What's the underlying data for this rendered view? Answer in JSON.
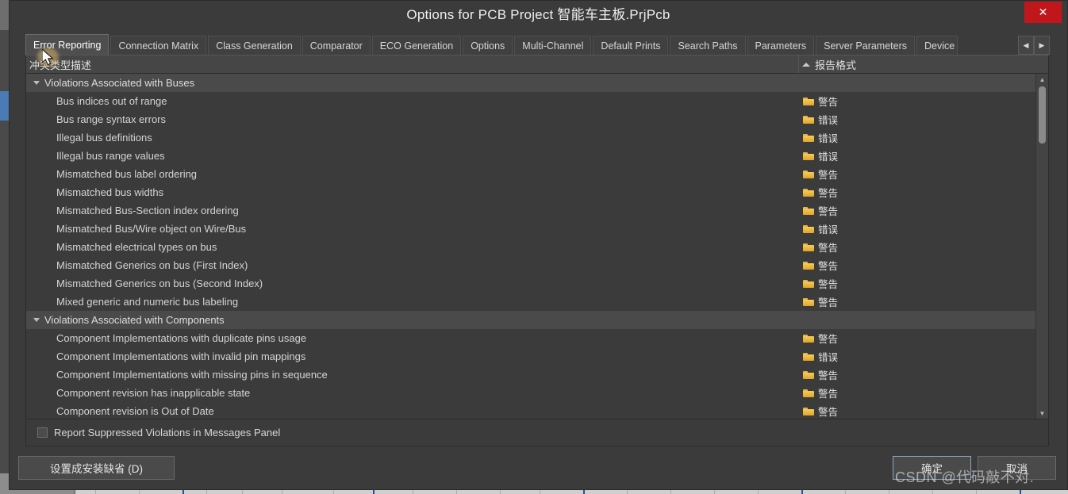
{
  "window": {
    "title": "Options for PCB Project 智能车主板.PrjPcb",
    "close_label": "✕"
  },
  "tabs": {
    "items": [
      {
        "label": "Error Reporting",
        "active": true
      },
      {
        "label": "Connection Matrix",
        "active": false
      },
      {
        "label": "Class Generation",
        "active": false
      },
      {
        "label": "Comparator",
        "active": false
      },
      {
        "label": "ECO Generation",
        "active": false
      },
      {
        "label": "Options",
        "active": false
      },
      {
        "label": "Multi-Channel",
        "active": false
      },
      {
        "label": "Default Prints",
        "active": false
      },
      {
        "label": "Search Paths",
        "active": false
      },
      {
        "label": "Parameters",
        "active": false
      },
      {
        "label": "Server Parameters",
        "active": false
      },
      {
        "label": "Device S",
        "active": false,
        "clipped": true
      }
    ],
    "scroll_left": "◀",
    "scroll_right": "▶"
  },
  "grid": {
    "columns": {
      "description": "冲突类型描述",
      "report_mode": "报告格式"
    },
    "rows": [
      {
        "type": "group",
        "label": "Violations Associated with Buses",
        "format": ""
      },
      {
        "type": "item",
        "label": "Bus indices out of range",
        "format": "警告"
      },
      {
        "type": "item",
        "label": "Bus range syntax errors",
        "format": "错误"
      },
      {
        "type": "item",
        "label": "Illegal bus definitions",
        "format": "错误"
      },
      {
        "type": "item",
        "label": "Illegal bus range values",
        "format": "错误"
      },
      {
        "type": "item",
        "label": "Mismatched bus label ordering",
        "format": "警告"
      },
      {
        "type": "item",
        "label": "Mismatched bus widths",
        "format": "警告"
      },
      {
        "type": "item",
        "label": "Mismatched Bus-Section index ordering",
        "format": "警告"
      },
      {
        "type": "item",
        "label": "Mismatched Bus/Wire object on Wire/Bus",
        "format": "错误"
      },
      {
        "type": "item",
        "label": "Mismatched electrical types on bus",
        "format": "警告"
      },
      {
        "type": "item",
        "label": "Mismatched Generics on bus (First Index)",
        "format": "警告"
      },
      {
        "type": "item",
        "label": "Mismatched Generics on bus (Second Index)",
        "format": "警告"
      },
      {
        "type": "item",
        "label": "Mixed generic and numeric bus labeling",
        "format": "警告"
      },
      {
        "type": "group",
        "label": "Violations Associated with Components",
        "format": ""
      },
      {
        "type": "item",
        "label": "Component Implementations with duplicate pins usage",
        "format": "警告"
      },
      {
        "type": "item",
        "label": "Component Implementations with invalid pin mappings",
        "format": "错误"
      },
      {
        "type": "item",
        "label": "Component Implementations with missing pins in sequence",
        "format": "警告"
      },
      {
        "type": "item",
        "label": "Component revision has inapplicable state",
        "format": "警告"
      },
      {
        "type": "item",
        "label": "Component revision is Out of Date",
        "format": "警告"
      }
    ]
  },
  "footer": {
    "checkbox_label": "Report Suppressed Violations in Messages Panel",
    "checkbox_checked": false,
    "default_button": "设置成安装缺省 (D)",
    "ok_button": "确定",
    "cancel_button": "取消"
  },
  "overlay": {
    "watermark": "CSDN @代码敲不对."
  },
  "scrollbar": {
    "up_arrow": "▲",
    "down_arrow": "▼"
  }
}
